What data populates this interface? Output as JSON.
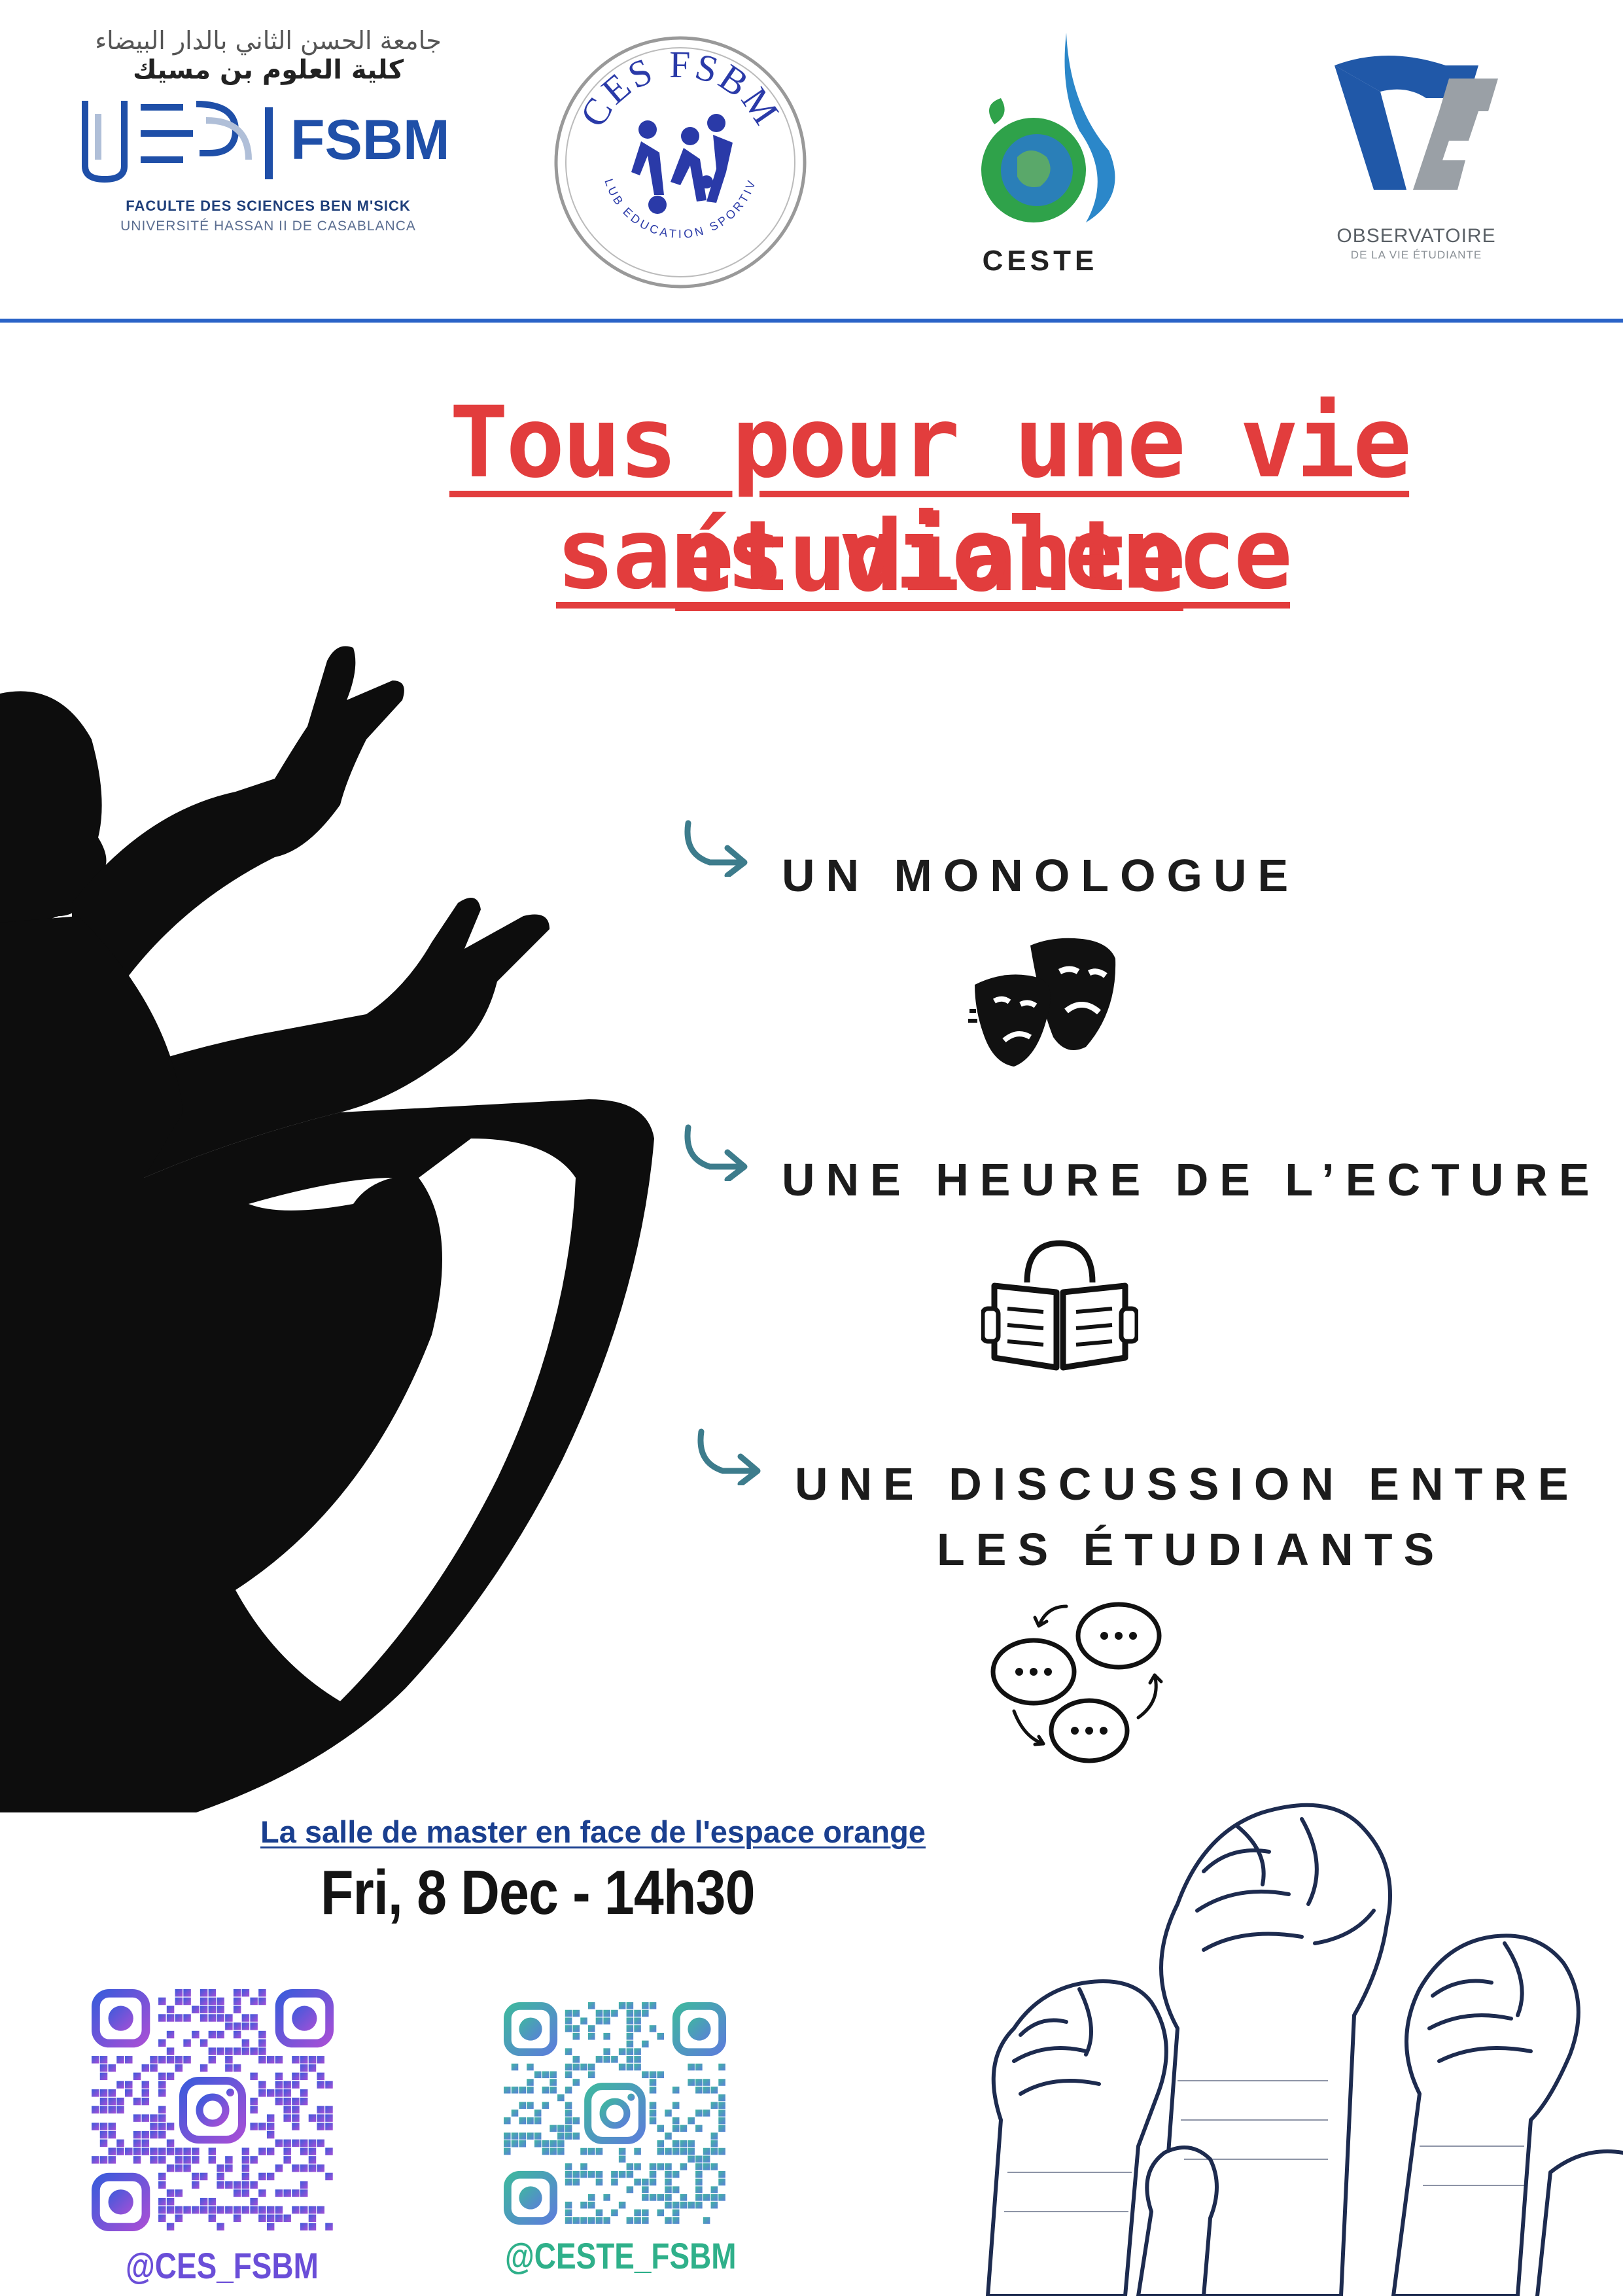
{
  "header": {
    "fsbm_logo": {
      "arabic_line1": "جامعة الحسن الثاني بالدار البيضاء",
      "arabic_line2": "كلية العلوم بن مسيك",
      "acronym": "FSBM",
      "faculty_name": "FACULTE DES SCIENCES BEN M'SICK",
      "university_name": "UNIVERSITÉ HASSAN II DE CASABLANCA"
    },
    "ces_logo": {
      "top_text": "CES FSBM",
      "bottom_text": "CLUB EDUCATION SPORTIVE"
    },
    "ceste_logo": {
      "name": "CESTE"
    },
    "observatoire_logo": {
      "line1": "OBSERVATOIRE",
      "line2": "DE LA VIE ÉTUDIANTE"
    },
    "rule_color": "#2a63c7"
  },
  "title": {
    "line1": "Tous pour une vie étudiante",
    "line2": "sans violence",
    "color": "#e23d3d"
  },
  "activities": [
    {
      "label": "UN MONOLOGUE",
      "icon": "theater-masks-icon"
    },
    {
      "label": "UNE HEURE DE L’ECTURE",
      "icon": "reading-book-icon"
    },
    {
      "label_line1": "UNE DISCUSSION ENTRE",
      "label_line2": "LES ÉTUDIANTS",
      "icon": "chat-bubbles-icon"
    }
  ],
  "arrow_color": "#3d7c8c",
  "event": {
    "venue": "La salle de master en face de l'espace orange",
    "datetime": "Fri, 8 Dec - 14h30"
  },
  "social": [
    {
      "handle": "@CES_FSBM",
      "color": "#6a4ed8",
      "icon": "instagram-icon"
    },
    {
      "handle": "@CESTE_FSBM",
      "color": "#2fb08a",
      "icon": "instagram-icon"
    }
  ]
}
